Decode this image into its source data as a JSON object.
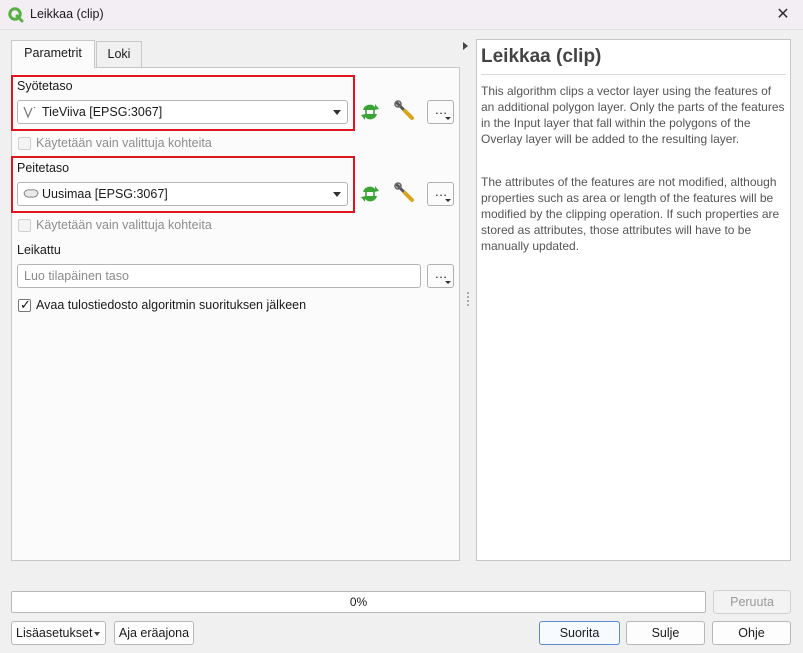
{
  "window": {
    "title": "Leikkaa (clip)",
    "close_glyph": "✕",
    "app_icon": "qgis-icon"
  },
  "tabs": [
    {
      "label": "Parametrit",
      "active": true
    },
    {
      "label": "Loki",
      "active": false
    }
  ],
  "params": {
    "input_layer": {
      "label": "Syötetaso",
      "value": "TieViiva [EPSG:3067]",
      "icon": "line-layer-icon"
    },
    "input_selected_only": {
      "label": "Käytetään vain valittuja kohteita",
      "checked": false,
      "enabled": false
    },
    "overlay_layer": {
      "label": "Peitetaso",
      "value": "Uusimaa [EPSG:3067]",
      "icon": "polygon-layer-icon"
    },
    "overlay_selected_only": {
      "label": "Käytetään vain valittuja kohteita",
      "checked": false,
      "enabled": false
    },
    "output": {
      "label": "Leikattu",
      "placeholder": "Luo tilapäinen taso"
    },
    "open_output": {
      "label": "Avaa tulostiedosto algoritmin suorituksen jälkeen",
      "checked": true
    },
    "browse_label": "…"
  },
  "help": {
    "title": "Leikkaa (clip)",
    "paragraph1": "This algorithm clips a vector layer using the features of an additional polygon layer. Only the parts of the features in the Input layer that fall within the polygons of the Overlay layer will be added to the resulting layer.",
    "paragraph2": "The attributes of the features are not modified, although properties such as area or length of the features will be modified by the clipping operation. If such properties are stored as attributes, those attributes will have to be manually updated."
  },
  "progress": {
    "text": "0%",
    "value": 0
  },
  "buttons": {
    "cancel": "Peruuta",
    "advanced": "Lisäasetukset",
    "batch": "Aja eräajona",
    "run": "Suorita",
    "close": "Sulje",
    "help": "Ohje"
  },
  "colors": {
    "highlight_box": "#e0161e",
    "iterate_icon": "#3aa335",
    "qgis_green": "#58b045"
  }
}
